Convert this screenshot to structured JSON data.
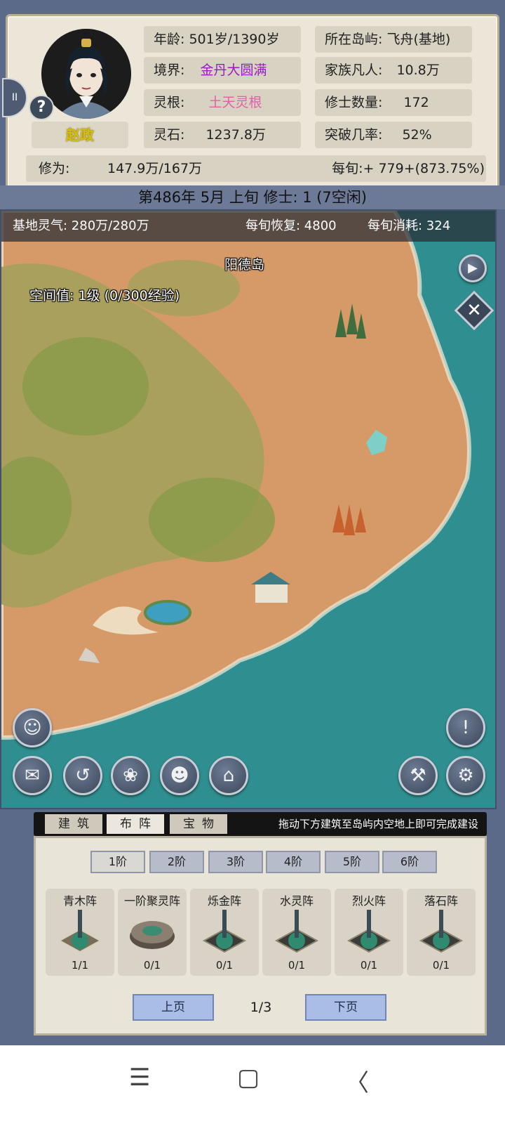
{
  "character": {
    "name": "赵政",
    "age_label": "年龄:",
    "age_value": "501岁/1390岁",
    "realm_label": "境界:",
    "realm_value": "金丹大圆满",
    "root_label": "灵根:",
    "root_value": "土天灵根",
    "stones_label": "灵石:",
    "stones_value": "1237.8万",
    "island_label": "所在岛屿:",
    "island_value": "飞舟(基地)",
    "mortals_label": "家族凡人:",
    "mortals_value": "10.8万",
    "cultivators_label": "修士数量:",
    "cultivators_value": "172",
    "breakthrough_label": "突破几率:",
    "breakthrough_value": "52%",
    "cultivation_label": "修为:",
    "cultivation_value": "147.9万/167万",
    "per_period_value": "每旬:+ 779+(873.75%)",
    "help_icon": "question-icon",
    "side_tab_label": "II"
  },
  "date_bar": "第486年 5月 上旬   修士: 1 (7空闲)",
  "map": {
    "qi_label": "基地灵气: 280万/280万",
    "recovery_label": "每旬恢复: 4800",
    "consume_label": "每旬消耗: 324",
    "island_name": "阳德岛",
    "space_level": "空间值: 1级 (0/300经验)",
    "colors": {
      "sea": "#2f8e8f",
      "sand": "#d59a68",
      "grass": "#a8a05c"
    }
  },
  "map_buttons": {
    "play_icon": "play-icon",
    "close_icon": "close-icon",
    "alert_icon": "exclamation-icon",
    "settings_icon": "gear-icon",
    "hammer_icon": "hammer-icon",
    "character_icon": "cultivator-avatar-icon",
    "bag_icon": "bag-icon",
    "scroll_icon": "scroll-icon",
    "herb_icon": "herb-icon",
    "disciple_icon": "disciple-icon",
    "gate_icon": "gate-icon"
  },
  "build": {
    "tabs": [
      "建筑",
      "布阵",
      "宝物"
    ],
    "active_tab": "布阵",
    "hint": "拖动下方建筑至岛屿内空地上即可完成建设",
    "tiers": [
      "1阶",
      "2阶",
      "3阶",
      "4阶",
      "5阶",
      "6阶"
    ],
    "active_tier": "1阶",
    "cards": [
      {
        "name": "青木阵",
        "count": "1/1"
      },
      {
        "name": "一阶聚灵阵",
        "count": "0/1"
      },
      {
        "name": "烁金阵",
        "count": "0/1"
      },
      {
        "name": "水灵阵",
        "count": "0/1"
      },
      {
        "name": "烈火阵",
        "count": "0/1"
      },
      {
        "name": "落石阵",
        "count": "0/1"
      }
    ],
    "prev_label": "上页",
    "next_label": "下页",
    "page": "1/3"
  },
  "system_nav": {
    "menu_glyph": "☰",
    "home_glyph": "▢",
    "back_glyph": "〈"
  }
}
